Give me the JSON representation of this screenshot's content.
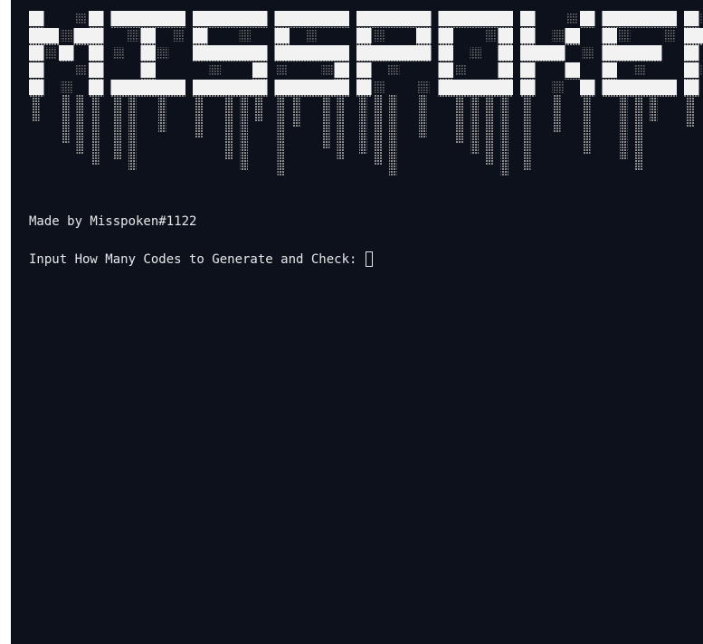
{
  "terminal": {
    "banner_text": "MISSPOKEN",
    "credit_line": "Made by Misspoken#1122",
    "prompt_text": "Input How Many Codes to Generate and Check: ",
    "input_value": ""
  },
  "colors": {
    "terminal_background": "#0d111c",
    "text": "#e8e8ea",
    "banner_bright": "#f2f2f2",
    "banner_dim": "#8c8c8c",
    "page_border": "#ffffff"
  },
  "icons": {
    "cursor": "block-cursor-icon"
  }
}
